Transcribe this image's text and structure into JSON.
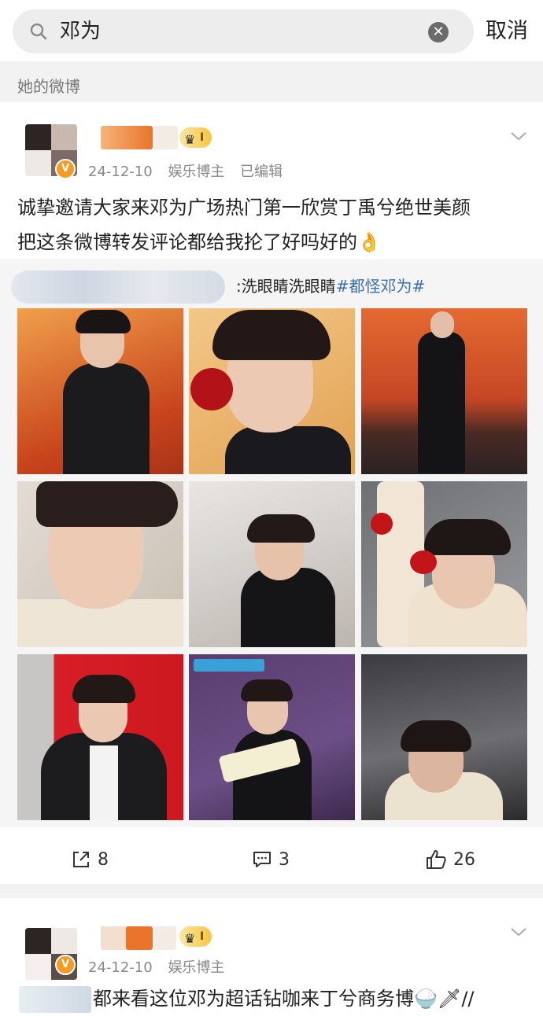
{
  "search": {
    "query": "邓为",
    "cancel_label": "取消"
  },
  "section_label": "她的微博",
  "post1": {
    "date": "24-12-10",
    "source": "娱乐博主",
    "edited": "已编辑",
    "badge_level": "I",
    "text_line1": "诚挚邀请大家来邓为广场热门第一欣赏丁禹兮绝世美颜",
    "text_line2": "把这条微博转发评论都给我抡了好吗好的👌",
    "repost_text_plain": ":洗眼睛洗眼睛",
    "repost_tag": "#都怪邓为#",
    "actions": {
      "reposts": "8",
      "comments": "3",
      "likes": "26"
    }
  },
  "post2": {
    "date": "24-12-10",
    "source": "娱乐博主",
    "badge_level": "I",
    "text": "都来看这位邓为超话钻咖来丁兮商务博🍚🗡//"
  },
  "icons": {
    "search": "search-icon",
    "clear": "clear-icon",
    "more": "chevron-down-icon",
    "repost": "repost-icon",
    "comment": "comment-icon",
    "like": "like-icon",
    "verified": "verified-badge-icon",
    "crown": "crown-icon"
  },
  "colors": {
    "accent_link": "#3a6fb3",
    "verified": "#f59a23",
    "crown": "#f5c542"
  }
}
